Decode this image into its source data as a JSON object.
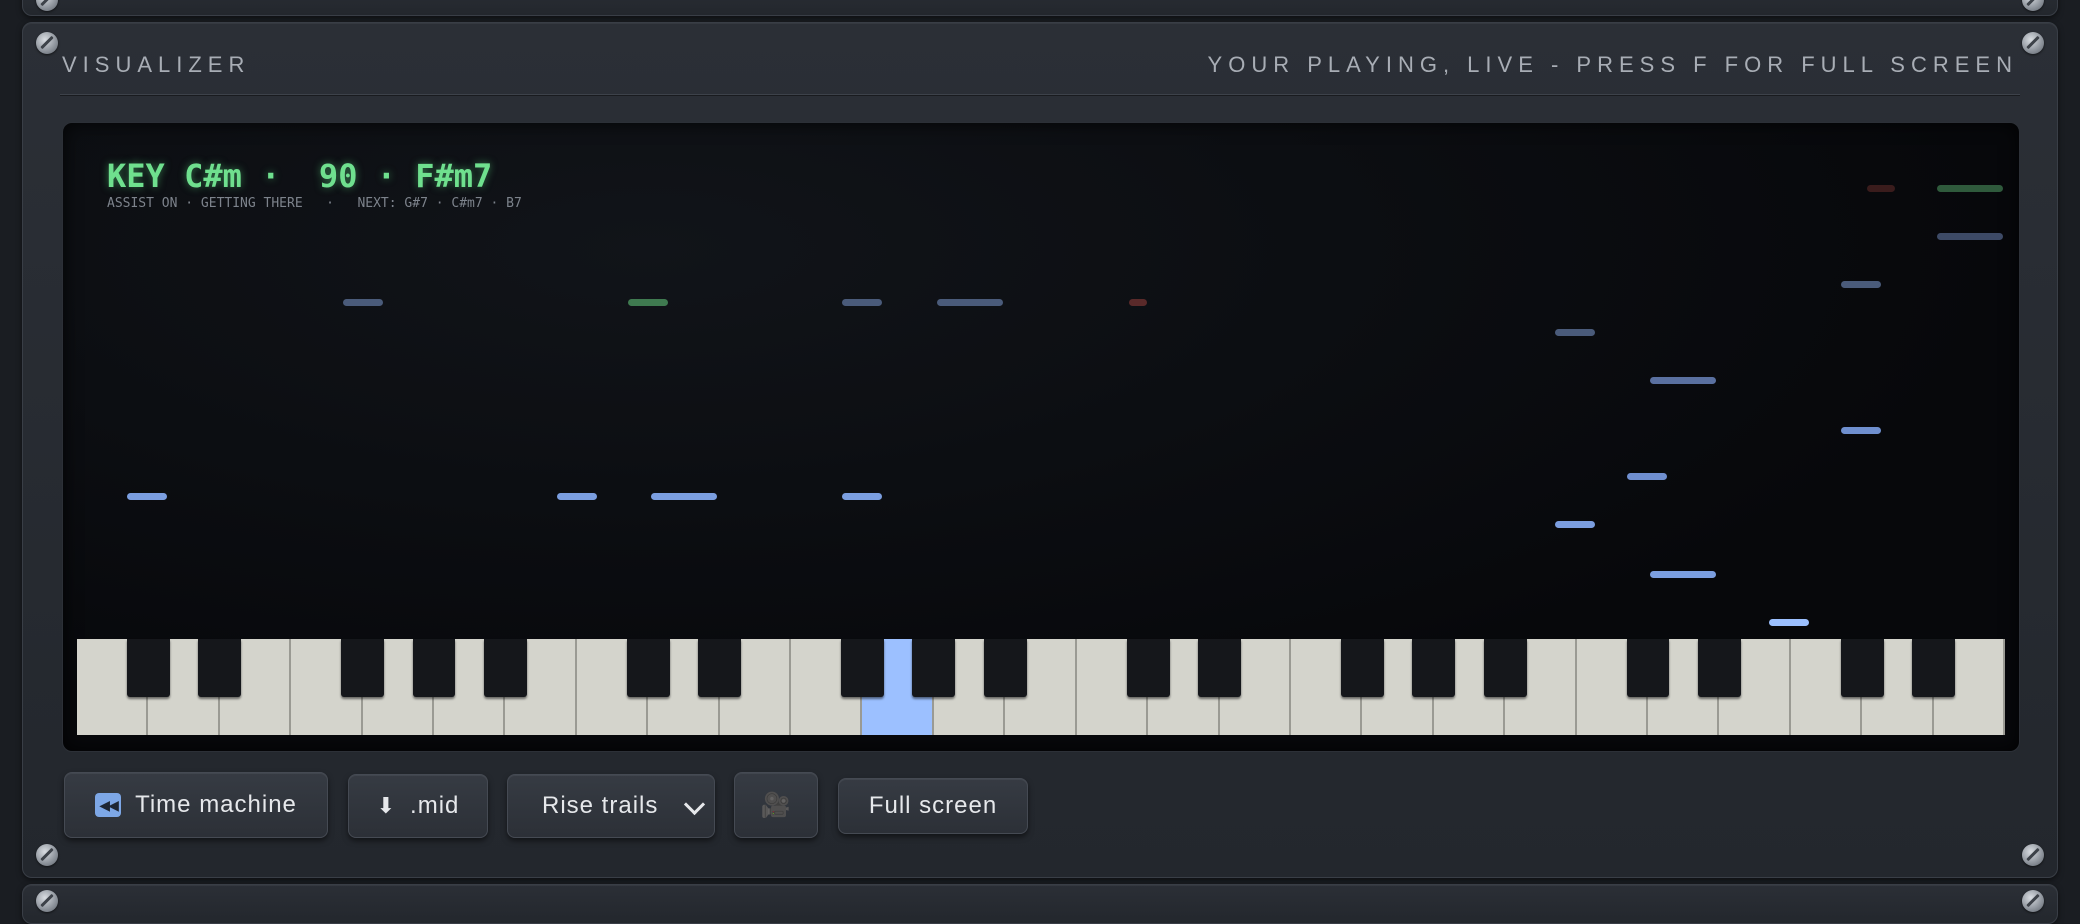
{
  "panel": {
    "title": "VISUALIZER",
    "hint": "YOUR PLAYING, LIVE - PRESS F FOR FULL SCREEN"
  },
  "hud": {
    "key_line": "KEY C#m ·  90 · F#m7",
    "status_line": "ASSIST ON · GETTING THERE   ·   NEXT: G#7 · C#m7 · B7"
  },
  "colors": {
    "accent_blue": "#7b9ee0",
    "active_blue": "#9cc0ff",
    "accent_green": "#4fd37a",
    "hud_green": "#6fe08e",
    "dim_red": "#5a2a2a"
  },
  "keyboard": {
    "white_key_count": 27,
    "highlighted_keys": [
      "blue",
      "green",
      "blue",
      "light-blue"
    ]
  },
  "controls": {
    "time_machine": {
      "icon": "rewind-icon",
      "label": "Time machine"
    },
    "download_mid": {
      "icon": "download-icon",
      "label": ".mid"
    },
    "mode_select": {
      "value": "Rise trails"
    },
    "camera": {
      "icon": "camera-icon",
      "label": "🎥"
    },
    "fullscreen": {
      "label": "Full screen"
    }
  }
}
